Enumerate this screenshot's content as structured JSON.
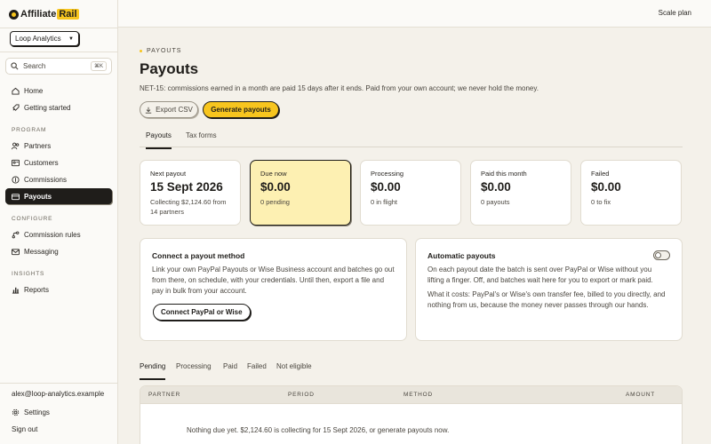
{
  "app": {
    "logo_left": "Affiliate",
    "logo_right": "Rail",
    "plan": "Scale plan"
  },
  "sidebar": {
    "workspace": "Loop Analytics",
    "search": {
      "label": "Search",
      "shortcut": "⌘K"
    },
    "items": [
      {
        "label": "Home",
        "icon": "home-icon"
      },
      {
        "label": "Getting started",
        "icon": "rocket-icon"
      }
    ],
    "program_label": "PROGRAM",
    "program_items": [
      {
        "label": "Partners",
        "icon": "users-icon"
      },
      {
        "label": "Customers",
        "icon": "id-card-icon"
      },
      {
        "label": "Commissions",
        "icon": "coin-icon"
      },
      {
        "label": "Payouts",
        "icon": "wallet-icon",
        "active": true
      }
    ],
    "configure_label": "CONFIGURE",
    "configure_items": [
      {
        "label": "Commission rules",
        "icon": "branch-icon"
      },
      {
        "label": "Messaging",
        "icon": "mail-icon"
      }
    ],
    "insights_label": "INSIGHTS",
    "insights_items": [
      {
        "label": "Reports",
        "icon": "chart-icon"
      }
    ],
    "user_email": "alex@loop-analytics.example",
    "settings": "Settings",
    "sign_out": "Sign out"
  },
  "page": {
    "breadcrumb": "PAYOUTS",
    "title": "Payouts",
    "subtitle": "NET-15: commissions earned in a month are paid 15 days after it ends. Paid from your own account; we never hold the money.",
    "export_label": "Export CSV",
    "generate_label": "Generate payouts",
    "tabs": [
      "Payouts",
      "Tax forms"
    ]
  },
  "cards": [
    {
      "label": "Next payout",
      "value": "15 Sept 2026",
      "sub": "Collecting $2,124.60 from 14 partners"
    },
    {
      "label": "Due now",
      "value": "$0.00",
      "sub": "0 pending"
    },
    {
      "label": "Processing",
      "value": "$0.00",
      "sub": "0 in flight"
    },
    {
      "label": "Paid this month",
      "value": "$0.00",
      "sub": "0 payouts"
    },
    {
      "label": "Failed",
      "value": "$0.00",
      "sub": "0 to fix"
    }
  ],
  "connect": {
    "title": "Connect a payout method",
    "body": "Link your own PayPal Payouts or Wise Business account and batches go out from there, on schedule, with your credentials. Until then, export a file and pay in bulk from your account.",
    "button": "Connect PayPal or Wise"
  },
  "auto": {
    "title": "Automatic payouts",
    "body": "On each payout date the batch is sent over PayPal or Wise without you lifting a finger. Off, and batches wait here for you to export or mark paid.",
    "cost": "What it costs: PayPal's or Wise's own transfer fee, billed to you directly, and nothing from us, because the money never passes through our hands.",
    "enabled": false
  },
  "status_tabs": [
    "Pending",
    "Processing",
    "Paid",
    "Failed",
    "Not eligible"
  ],
  "table": {
    "columns": [
      "PARTNER",
      "PERIOD",
      "METHOD",
      "AMOUNT"
    ],
    "empty": "Nothing due yet. $2,124.60 is collecting for 15 Sept 2026, or generate payouts now."
  }
}
